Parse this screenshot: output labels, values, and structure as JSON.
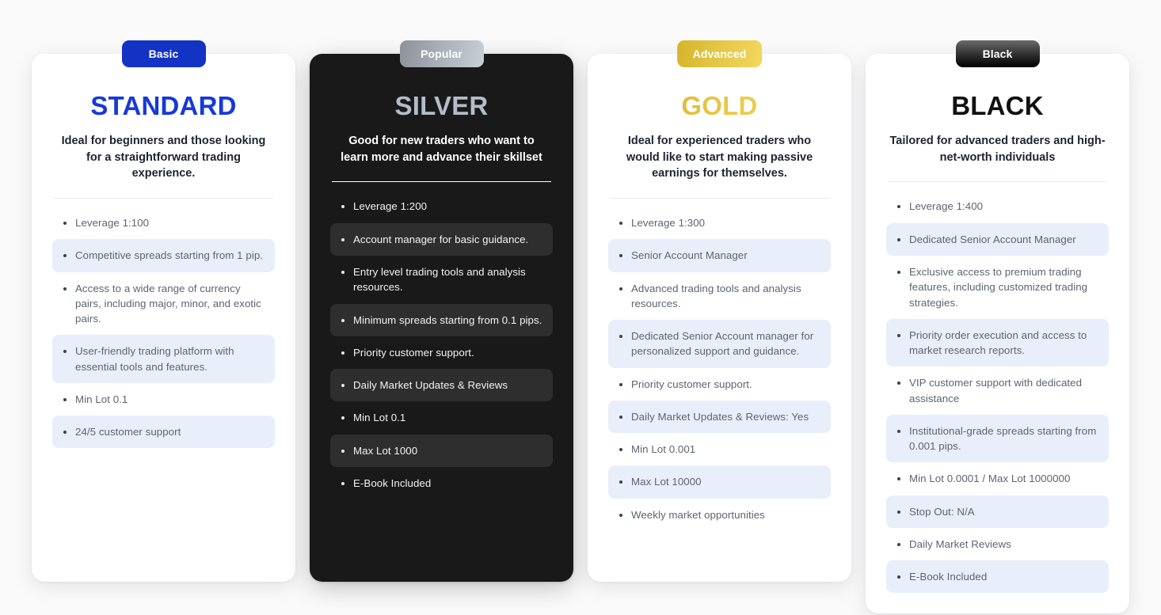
{
  "page": {
    "background_color": "#fafafa",
    "highlight_row_color": "#e9eefb",
    "dark_card_color": "#191919"
  },
  "plans": [
    {
      "badge": "Basic",
      "badge_style": "basic",
      "title": "STANDARD",
      "title_style": "standard",
      "subtitle": "Ideal for beginners and those looking for a straightforward trading experience.",
      "theme": "light",
      "features": [
        "Leverage 1:100",
        "Competitive spreads starting from 1 pip.",
        "Access to a wide range of currency pairs, including major, minor, and exotic pairs.",
        "User-friendly trading platform with essential tools and features.",
        "Min Lot 0.1",
        "24/5 customer support"
      ]
    },
    {
      "badge": "Popular",
      "badge_style": "popular",
      "title": "SILVER",
      "title_style": "silver",
      "subtitle": "Good for new traders who want to learn more and advance their skillset",
      "theme": "dark",
      "features": [
        "Leverage 1:200",
        "Account manager for basic guidance.",
        "Entry level trading tools and analysis resources.",
        "Minimum spreads starting from 0.1 pips.",
        "Priority customer support.",
        "Daily Market Updates & Reviews",
        "Min Lot 0.1",
        "Max Lot 1000",
        "E-Book Included"
      ]
    },
    {
      "badge": "Advanced",
      "badge_style": "advanced",
      "title": "GOLD",
      "title_style": "gold",
      "subtitle": "Ideal for experienced traders who would like to start making passive earnings for themselves.",
      "theme": "light",
      "features": [
        "Leverage 1:300",
        "Senior Account Manager",
        "Advanced trading tools and analysis resources.",
        "Dedicated Senior Account manager for personalized support and guidance.",
        "Priority customer support.",
        "Daily Market Updates & Reviews: Yes",
        "Min Lot 0.001",
        "Max Lot 10000",
        "Weekly market opportunities"
      ]
    },
    {
      "badge": "Black",
      "badge_style": "black",
      "title": "BLACK",
      "title_style": "black",
      "subtitle": "Tailored for advanced traders and high-net-worth individuals",
      "theme": "light",
      "features": [
        "Leverage 1:400",
        "Dedicated Senior Account Manager",
        "Exclusive access to premium trading features, including customized trading strategies.",
        "Priority order execution and access to market research reports.",
        "VIP customer support with dedicated assistance",
        "Institutional-grade spreads starting from 0.001 pips.",
        "Min Lot 0.0001 / Max Lot 1000000",
        "Stop Out: N/A",
        "Daily Market Reviews",
        "E-Book Included"
      ]
    }
  ]
}
